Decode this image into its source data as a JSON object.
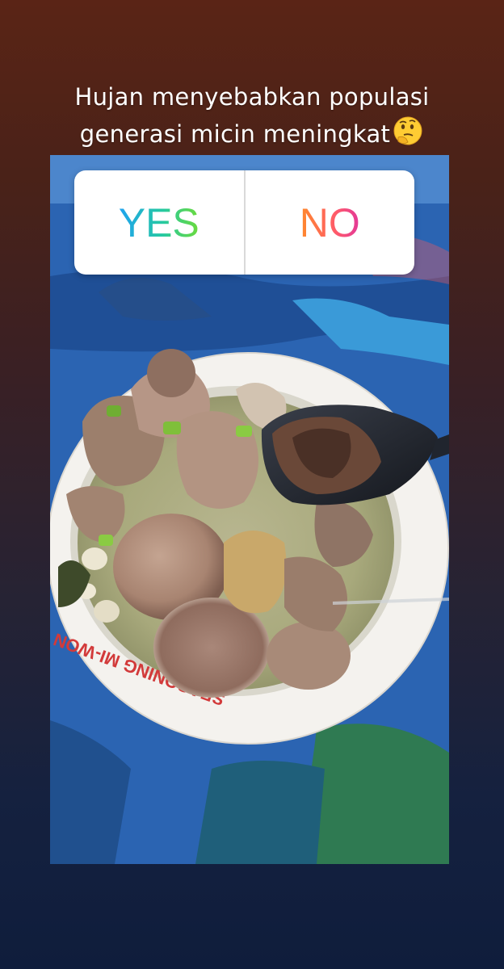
{
  "story": {
    "caption_line1": "Hujan menyebabkan populasi",
    "caption_line2": "generasi micin meningkat",
    "caption_emoji": "thinking-face-emoji",
    "background_top": "#5a2416",
    "background_bottom": "#0f1d3c"
  },
  "poll": {
    "yes_label": "YES",
    "no_label": "NO",
    "yes_gradient": [
      "#1fa3f0",
      "#25c9a0",
      "#6ddb3a"
    ],
    "no_gradient": [
      "#ff8a2a",
      "#ff5a6a",
      "#e2379a"
    ]
  },
  "photo": {
    "subject": "bowl-of-meatball-soup",
    "bowl_print": "SEASONING MI-WON"
  }
}
